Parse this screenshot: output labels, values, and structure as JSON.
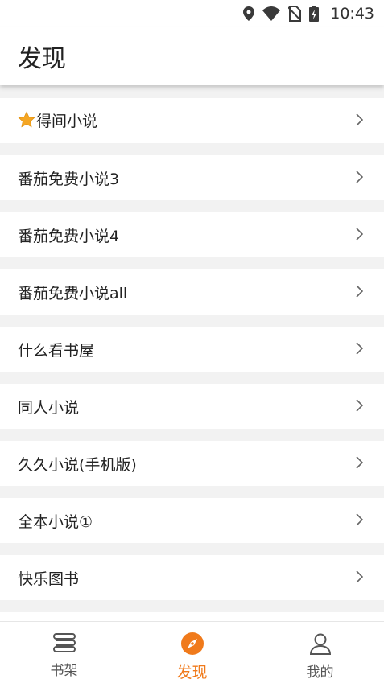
{
  "status_bar": {
    "time": "10:43"
  },
  "header": {
    "title": "发现"
  },
  "list": [
    {
      "label": "得间小说",
      "starred": true
    },
    {
      "label": "番茄免费小说3"
    },
    {
      "label": "番茄免费小说4"
    },
    {
      "label": "番茄免费小说all"
    },
    {
      "label": "什么看书屋"
    },
    {
      "label": "同人小说"
    },
    {
      "label": "久久小说(手机版)"
    },
    {
      "label": "全本小说①"
    },
    {
      "label": "快乐图书"
    }
  ],
  "bottom_nav": [
    {
      "label": "书架",
      "icon": "bookshelf-icon",
      "active": false
    },
    {
      "label": "发现",
      "icon": "compass-icon",
      "active": true
    },
    {
      "label": "我的",
      "icon": "person-icon",
      "active": false
    }
  ],
  "colors": {
    "accent": "#f07a1b",
    "star": "#f5a623",
    "background": "#f2f2f2"
  }
}
